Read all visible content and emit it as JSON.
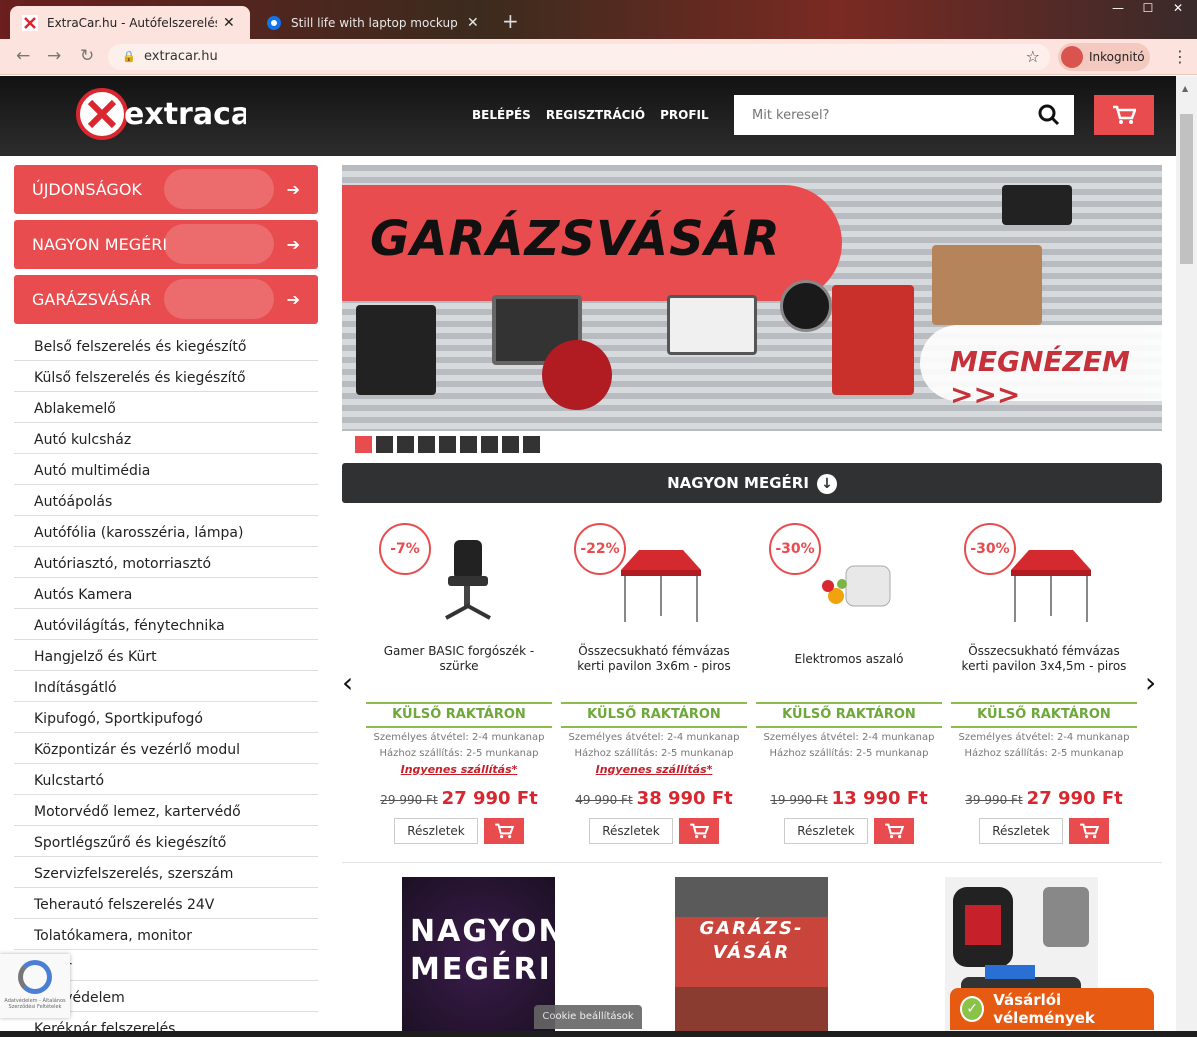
{
  "browser": {
    "tabs": [
      {
        "title": "ExtraCar.hu - Autófelszerelés és m",
        "active": true
      },
      {
        "title": "Still life with laptop mockup | Fre",
        "active": false
      }
    ],
    "url": "extracar.hu",
    "profile_label": "Inkognitó"
  },
  "site": {
    "logo_text": "extracar",
    "menu": [
      "BELÉPÉS",
      "REGISZTRÁCIÓ",
      "PROFIL"
    ],
    "search_placeholder": "Mit keresel?",
    "accent_color": "#e84c4f"
  },
  "sidebar": {
    "featured": [
      "ÚJDONSÁGOK",
      "NAGYON MEGÉRI",
      "GARÁZSVÁSÁR"
    ],
    "categories": [
      "Belső felszerelés és kiegészítő",
      "Külső felszerelés és kiegészítő",
      "Ablakemelő",
      "Autó kulcsház",
      "Autó multimédia",
      "Autóápolás",
      "Autófólia (karosszéria, lámpa)",
      "Autóriasztó, motorriasztó",
      "Autós Kamera",
      "Autóvilágítás, fénytechnika",
      "Hangjelző és Kürt",
      "Indításgátló",
      "Kipufogó, Sportkipufogó",
      "Központizár és vezérlő modul",
      "Kulcstartó",
      "Motorvédő lemez, kartervédő",
      "Sportlégszűrő és kiegészítő",
      "Szervizfelszerelés, szerszám",
      "Teherautó felszerelés 24V",
      "Tolatókamera, monitor",
      "radar",
      "pax védelem",
      "Keréknár felszerelés"
    ]
  },
  "banner": {
    "title": "GARÁZSVÁSÁR",
    "cta": "MEGNÉZEM >>>",
    "slides": 9,
    "active_slide": 1
  },
  "section_title": "NAGYON MEGÉRI",
  "products": [
    {
      "discount": "-7%",
      "name": "Gamer BASIC forgószék - szürke",
      "stock": "KÜLSŐ RAKTÁRON",
      "pickup": "Személyes átvétel: 2-4 munkanap",
      "delivery": "Házhoz szállítás: 2-5 munkanap",
      "free_shipping": "Ingyenes szállítás*",
      "old_price": "29 990 Ft",
      "price": "27 990 Ft"
    },
    {
      "discount": "-22%",
      "name": "Összecsukható fémvázas kerti pavilon 3x6m - piros",
      "stock": "KÜLSŐ RAKTÁRON",
      "pickup": "Személyes átvétel: 2-4 munkanap",
      "delivery": "Házhoz szállítás: 2-5 munkanap",
      "free_shipping": "Ingyenes szállítás*",
      "old_price": "49 990 Ft",
      "price": "38 990 Ft"
    },
    {
      "discount": "-30%",
      "name": "Elektromos aszaló",
      "stock": "KÜLSŐ RAKTÁRON",
      "pickup": "Személyes átvétel: 2-4 munkanap",
      "delivery": "Házhoz szállítás: 2-5 munkanap",
      "free_shipping": "",
      "old_price": "19 990 Ft",
      "price": "13 990 Ft"
    },
    {
      "discount": "-30%",
      "name": "Összecsukható fémvázas kerti pavilon 3x4,5m - piros",
      "stock": "KÜLSŐ RAKTÁRON",
      "pickup": "Személyes átvétel: 2-4 munkanap",
      "delivery": "Házhoz szállítás: 2-5 munkanap",
      "free_shipping": "",
      "old_price": "39 990 Ft",
      "price": "27 990 Ft"
    }
  ],
  "details_label": "Részletek",
  "promo_tiles": [
    "NAGYON MEGÉRI!",
    "GARÁZS-VÁSÁR"
  ],
  "cookie_label": "Cookie beállítások",
  "reviews_label": "Vásárlói vélemények",
  "recaptcha_text": "Adatvédelem - Általános Szerződési Feltételek"
}
